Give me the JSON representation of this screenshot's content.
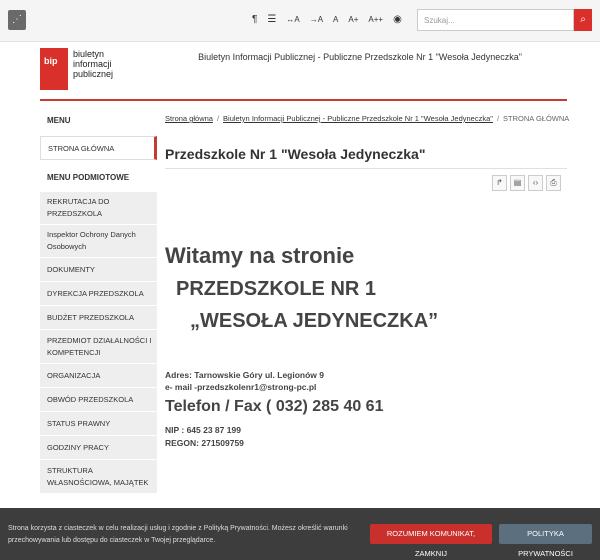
{
  "topbar": {
    "rss_icon": "rss-icon",
    "tools": [
      {
        "name": "paragraph-icon",
        "label": "¶"
      },
      {
        "name": "line-height-icon",
        "label": "☰"
      },
      {
        "name": "letter-spacing-wide-icon",
        "label": "↔A"
      },
      {
        "name": "letter-spacing-narrow-icon",
        "label": "→A"
      },
      {
        "name": "font-normal-button",
        "label": "A"
      },
      {
        "name": "font-larger-button",
        "label": "A+"
      },
      {
        "name": "font-largest-button",
        "label": "A++"
      },
      {
        "name": "contrast-icon",
        "label": "◉"
      }
    ],
    "search_placeholder": "Szukaj...",
    "search_icon": "search-icon"
  },
  "header": {
    "logo_mark": "bip",
    "logo_text_line1": "biuletyn",
    "logo_text_line2": "informacji publicznej",
    "title": "Biuletyn Informacji Publicznej - Publiczne Przedszkole Nr 1 \"Wesoła Jedyneczka\"",
    "accent_color": "#c73b33"
  },
  "sidebar": {
    "menu_label": "MENU",
    "current_item": "STRONA GŁÓWNA",
    "sub_label": "MENU PODMIOTOWE",
    "items": [
      "REKRUTACJA DO PRZEDSZKOLA",
      "Inspektor Ochrony Danych Osobowych",
      "DOKUMENTY",
      "DYREKCJA PRZEDSZKOLA",
      "BUDŻET PRZEDSZKOLA",
      "PRZEDMIOT DZIAŁALNOŚCI I KOMPETENCJI",
      "ORGANIZACJA",
      "OBWÓD PRZEDSZKOLA",
      "STATUS PRAWNY",
      "GODZINY PRACY",
      "STRUKTURA WŁASNOŚCIOWA, MAJĄTEK"
    ]
  },
  "breadcrumb": {
    "home": "Strona główna",
    "bip": "Biuletyn Informacji Publicznej - Publiczne Przedszkole Nr 1 \"Wesoła Jedyneczka\"",
    "current": "STRONA GŁÓWNA"
  },
  "main": {
    "title": "Przedszkole Nr 1 \"Wesoła Jedyneczka\"",
    "actions": [
      {
        "name": "share-icon",
        "glyph": "↱"
      },
      {
        "name": "pdf-icon",
        "glyph": "▤"
      },
      {
        "name": "code-icon",
        "glyph": "‹›"
      },
      {
        "name": "print-icon",
        "glyph": "⎙"
      }
    ],
    "welcome": "Witamy na stronie",
    "school_line1": "PRZEDSZKOLE NR 1",
    "school_line2": "„WESOŁA JEDYNECZKA”",
    "address": "Adres: Tarnowskie Góry ul. Legionów 9",
    "email": "e- mail -przedszkolenr1@strong-pc.pl",
    "phone": "Telefon / Fax ( 032) 285 40 61",
    "nip": "NIP : 645 23 87 199",
    "regon": "REGON: 271509759"
  },
  "cookie": {
    "text": "Strona korzysta z ciasteczek w celu realizacji usług i zgodnie z Polityką Prywatności. Możesz określić warunki przechowywania lub dostępu do ciasteczek w Twojej przeglądarce.",
    "accept_label": "ROZUMIEM KOMUNIKAT, ZAMKNIJ",
    "policy_label": "POLITYKA PRYWATNOŚCI"
  }
}
